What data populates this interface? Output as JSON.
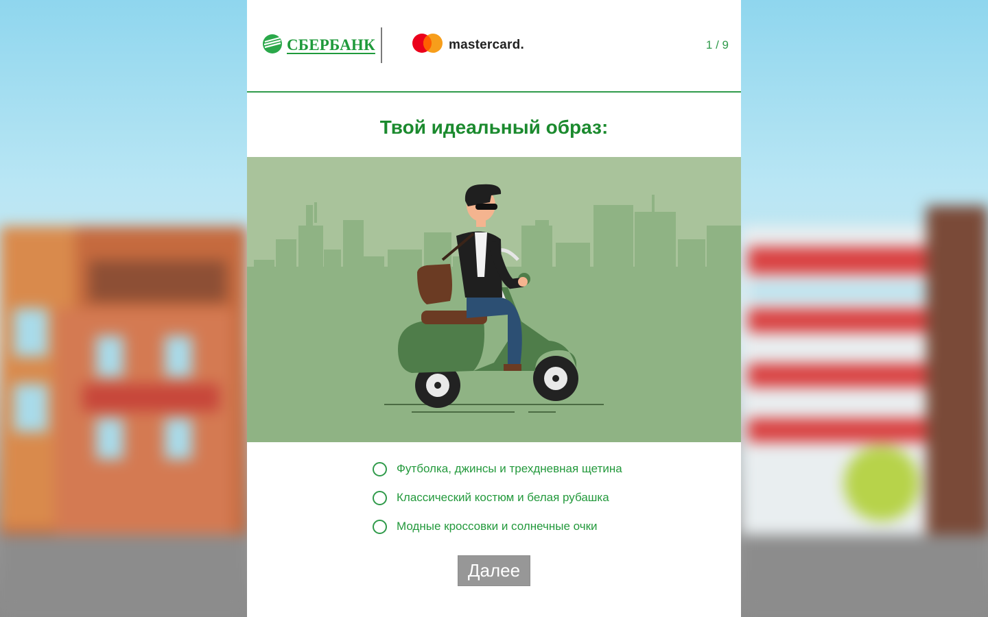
{
  "header": {
    "sber_logo_text": "СБЕРБАНК",
    "mastercard_text": "mastercard.",
    "progress": "1 / 9"
  },
  "question": {
    "title": "Твой идеальный образ:"
  },
  "options": [
    {
      "label": "Футболка, джинсы и трехдневная щетина",
      "selected": false
    },
    {
      "label": "Классический костюм и белая рубашка",
      "selected": false
    },
    {
      "label": "Модные кроссовки и солнечные очки",
      "selected": false
    }
  ],
  "next_button": {
    "label": "Далее",
    "enabled": false
  },
  "colors": {
    "brand_green": "#1f9a3b",
    "illustration_bg": "#a9c39b",
    "city_silhouette": "#8fb384",
    "button_disabled": "#979797"
  },
  "icons": [
    "sberbank-logo-icon",
    "mastercard-logo-icon",
    "radio-icon",
    "scooter-rider-illustration"
  ]
}
